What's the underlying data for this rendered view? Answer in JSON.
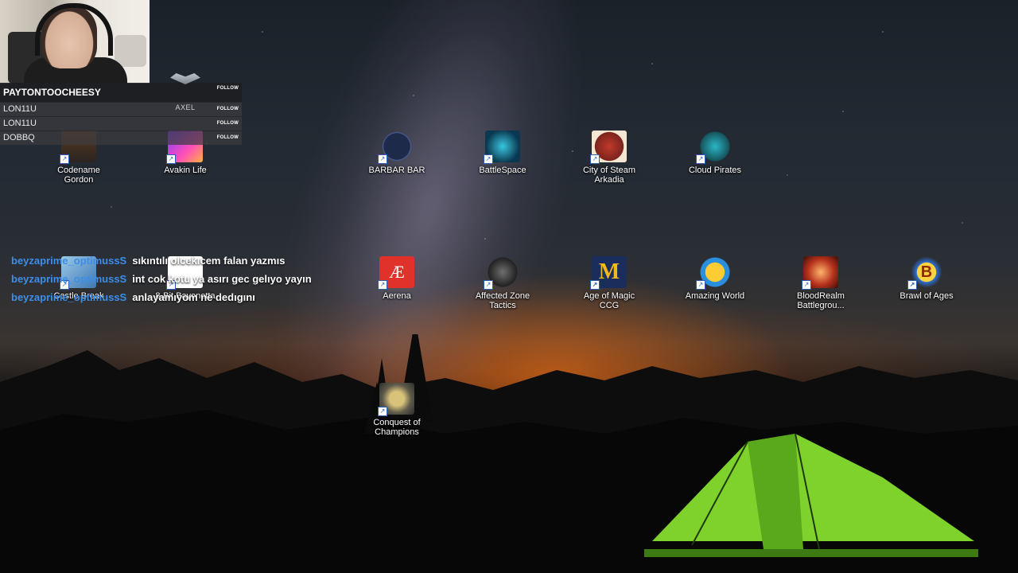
{
  "stream_overlay": {
    "webcam": {
      "alt": "streamer webcam"
    },
    "followers": {
      "header_name": "PAYTONTOOCHEESY",
      "follow_label": "FOLLOW",
      "rows": [
        {
          "name": "LON11U",
          "tag": "FOLLOW"
        },
        {
          "name": "LON11U",
          "tag": "FOLLOW"
        },
        {
          "name": "DOBBQ",
          "tag": "FOLLOW"
        }
      ],
      "badge_name": "AXEL"
    },
    "chat": [
      {
        "user": "beyzaprime_optimussS",
        "text": "sıkıntılı olcekıcem falan yazmıs"
      },
      {
        "user": "beyzaprime_optimussS",
        "text": "int cok kotu ya asırı gec gelıyo yayın"
      },
      {
        "user": "beyzaprime_optimussS",
        "text": "anlayamıyom ne dedıgını"
      }
    ]
  },
  "desktop": {
    "icons": {
      "codename_gordon": {
        "label": "Codename Gordon",
        "icon": "codename-gordon-icon"
      },
      "avakin_life": {
        "label": "Avakin Life",
        "icon": "avakin-life-icon"
      },
      "barbar_bar": {
        "label": "BARBAR BAR",
        "icon": "barbar-bar-icon"
      },
      "battlespace": {
        "label": "BattleSpace",
        "icon": "battlespace-icon"
      },
      "city_of_steam": {
        "label": "City of Steam Arkadia",
        "icon": "city-of-steam-icon"
      },
      "cloud_pirates": {
        "label": "Cloud Pirates",
        "icon": "cloud-pirates-icon"
      },
      "castle_break": {
        "label": "Castle Break",
        "icon": "castle-break-icon"
      },
      "bit_bayonetta": {
        "label": "8-Bit Bayonetta",
        "icon": "bayonetta-icon"
      },
      "aerena": {
        "label": "Aerena",
        "icon": "aerena-icon"
      },
      "affected_zone": {
        "label": "Affected Zone Tactics",
        "icon": "affected-zone-icon"
      },
      "age_of_magic": {
        "label": "Age of Magic CCG",
        "icon": "age-of-magic-icon"
      },
      "amazing_world": {
        "label": "Amazing World",
        "icon": "amazing-world-icon"
      },
      "bloodrealm": {
        "label": "BloodRealm Battlegrou...",
        "icon": "bloodrealm-icon"
      },
      "brawl_of_ages": {
        "label": "Brawl of Ages",
        "icon": "brawl-of-ages-icon"
      },
      "conquest": {
        "label": "Conquest of Champions",
        "icon": "conquest-icon"
      }
    }
  }
}
